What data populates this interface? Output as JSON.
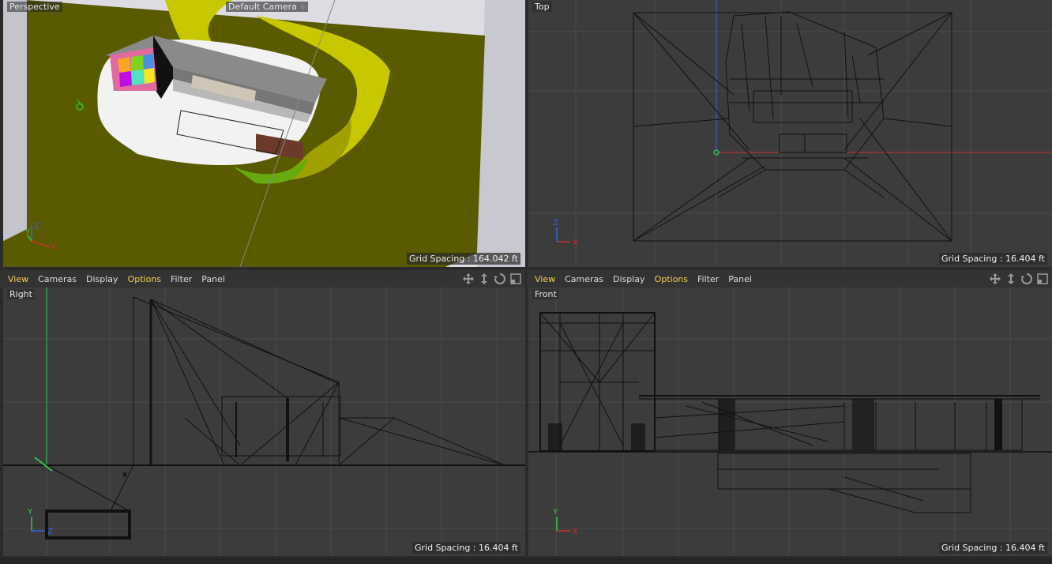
{
  "viewports": {
    "perspective": {
      "label": "Perspective",
      "camera": "Default Camera",
      "camera_icon": "camera-dots-icon",
      "grid_spacing": "Grid Spacing : 164.042 ft"
    },
    "top": {
      "label": "Top",
      "grid_spacing": "Grid Spacing : 16.404 ft"
    },
    "right": {
      "label": "Right",
      "grid_spacing": "Grid Spacing : 16.404 ft"
    },
    "front": {
      "label": "Front",
      "grid_spacing": "Grid Spacing : 16.404 ft"
    }
  },
  "menus": {
    "bottom_left": [
      "View",
      "Cameras",
      "Display",
      "Options",
      "Filter",
      "Panel"
    ],
    "bottom_right": [
      "View",
      "Cameras",
      "Display",
      "Options",
      "Filter",
      "Panel"
    ]
  },
  "axes": {
    "perspective": {
      "up": "Z",
      "side": "Y",
      "right": "X"
    },
    "top": {
      "up": "Z",
      "right": "X"
    },
    "right": {
      "up": "Y",
      "right": "Z"
    },
    "front": {
      "up": "Y",
      "right": "X"
    }
  },
  "nav_icons": [
    "move-view-icon",
    "dolly-view-icon",
    "rotate-view-icon",
    "maximize-view-icon"
  ],
  "colors": {
    "viewport_bg": "#3c3c3c",
    "grid": "#4a4a4a",
    "terrain": "#5a5a00",
    "axis_x": "#c83232",
    "axis_y": "#32c850",
    "axis_z": "#3264dc",
    "menu_accent": "#f2cf50"
  }
}
